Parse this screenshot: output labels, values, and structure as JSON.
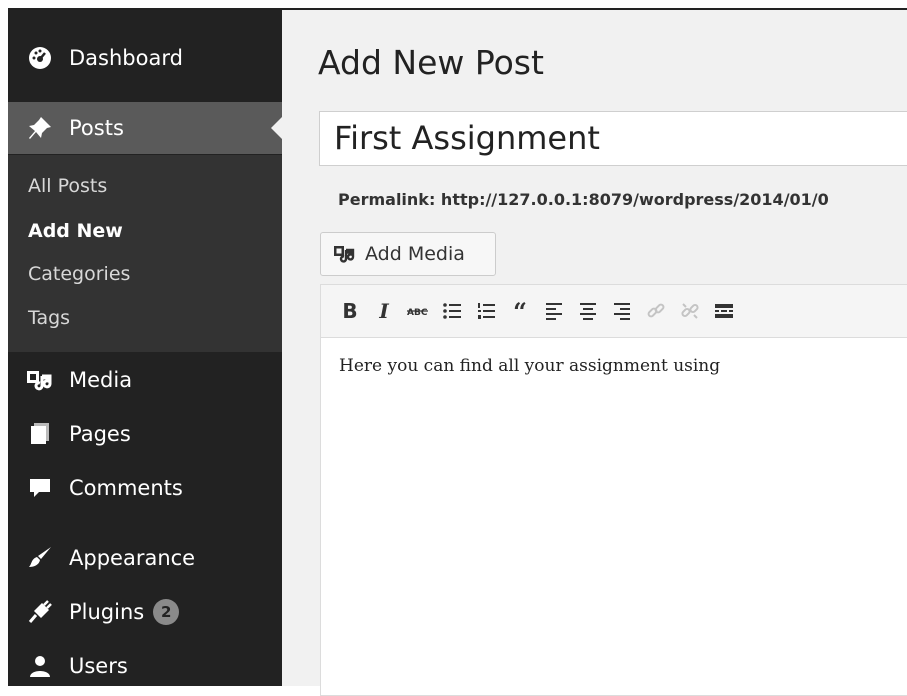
{
  "sidebar": {
    "dashboard": "Dashboard",
    "posts": "Posts",
    "submenu": {
      "all_posts": "All Posts",
      "add_new": "Add New",
      "categories": "Categories",
      "tags": "Tags"
    },
    "media": "Media",
    "pages": "Pages",
    "comments": "Comments",
    "appearance": "Appearance",
    "plugins": "Plugins",
    "plugins_badge": "2",
    "users": "Users"
  },
  "main": {
    "page_title": "Add New Post",
    "post_title": "First Assignment",
    "permalink_label": "Permalink:",
    "permalink_url": "http://127.0.0.1:8079/wordpress/2014/01/0",
    "add_media_label": "Add Media",
    "editor_content": "Here you can find all your assignment using"
  },
  "toolbar_icons": [
    "bold-icon",
    "italic-icon",
    "strikethrough-icon",
    "bullet-list-icon",
    "numbered-list-icon",
    "blockquote-icon",
    "align-left-icon",
    "align-center-icon",
    "align-right-icon",
    "link-icon",
    "unlink-icon",
    "read-more-icon"
  ]
}
